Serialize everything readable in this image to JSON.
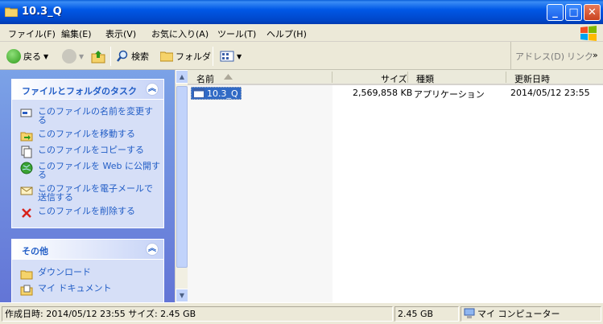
{
  "window": {
    "title": "10.3_Q"
  },
  "menu": [
    "ファイル(F)",
    "編集(E)",
    "表示(V)",
    "お気に入り(A)",
    "ツール(T)",
    "ヘルプ(H)"
  ],
  "toolbar": {
    "back": "戻る",
    "search": "検索",
    "folders": "フォルダ",
    "address": "アドレス(D)",
    "links": "リンク"
  },
  "tasks": {
    "header": "ファイルとフォルダのタスク",
    "items": [
      [
        "このファイルの名前を変更す",
        "る"
      ],
      [
        "このファイルを移動する"
      ],
      [
        "このファイルをコピーする"
      ],
      [
        "このファイルを Web に公開す",
        "る"
      ],
      [
        "このファイルを電子メールで",
        "送信する"
      ],
      [
        "このファイルを削除する"
      ]
    ]
  },
  "other": {
    "header": "その他",
    "items": [
      "ダウンロード",
      "マイ ドキュメント"
    ]
  },
  "columns": {
    "name": "名前",
    "size": "サイズ",
    "type": "種類",
    "modified": "更新日時"
  },
  "files": [
    {
      "name": "10.3_Q",
      "size": "2,569,858 KB",
      "type": "アプリケーション",
      "modified": "2014/05/12 23:55"
    }
  ],
  "status": {
    "info": "作成日時: 2014/05/12 23:55 サイズ: 2.45 GB",
    "size": "2.45 GB",
    "location": "マイ コンピューター"
  }
}
